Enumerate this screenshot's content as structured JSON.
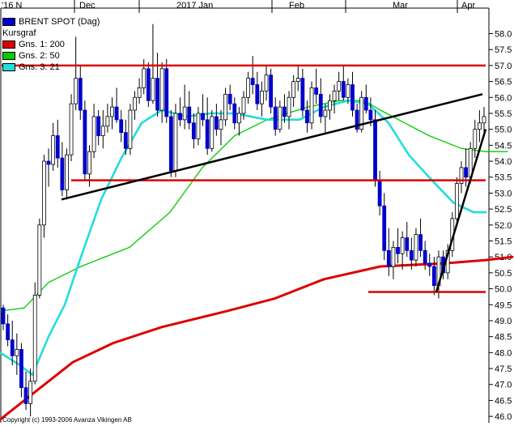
{
  "chart_data": {
    "type": "candlestick",
    "title": "BRENT SPOT (Dag)",
    "chart_label": "Kursgraf",
    "copyright": "Copyright (c) 1993-2006 Avanza Vikingen AB",
    "x_labels": [
      "'16 N",
      "Dec",
      "2017 Jan",
      "Feb",
      "Mar",
      "Apr"
    ],
    "y_ticks": [
      "46.0",
      "46.5",
      "47.0",
      "47.5",
      "48.0",
      "48.5",
      "49.0",
      "49.5",
      "50.0",
      "50.5",
      "51.0",
      "51.5",
      "52.0",
      "52.5",
      "53.0",
      "53.5",
      "54.0",
      "54.5",
      "55.0",
      "55.5",
      "56.0",
      "56.5",
      "57.0",
      "57.5",
      "58.0"
    ],
    "ylim": [
      45.8,
      58.8
    ],
    "grid": false,
    "legend_position": "top-left",
    "colors": {
      "candle": "#0000cc",
      "ma200": "#dd0000",
      "ma50": "#00cc00",
      "ma21": "#22dddd",
      "level": "#dd0000",
      "trend": "#000000"
    },
    "legend": [
      {
        "label": "BRENT SPOT (Dag)",
        "color": "#0000cc"
      },
      {
        "label": "Kursgraf",
        "color": ""
      },
      {
        "label": "Gns. 1: 200",
        "color": "#dd0000"
      },
      {
        "label": "Gns. 2: 50",
        "color": "#00cc00"
      },
      {
        "label": "Gns. 3: 21",
        "color": "#22dddd"
      }
    ],
    "ohlc": [
      [
        49.4,
        49.5,
        48.7,
        48.9
      ],
      [
        48.9,
        49.2,
        48.2,
        48.4
      ],
      [
        48.4,
        49.0,
        47.6,
        47.9
      ],
      [
        47.9,
        48.6,
        47.3,
        48.1
      ],
      [
        48.1,
        48.3,
        46.6,
        46.9
      ],
      [
        46.9,
        47.4,
        46.2,
        46.4
      ],
      [
        46.4,
        47.5,
        46.0,
        47.1
      ],
      [
        47.1,
        50.2,
        47.0,
        49.8
      ],
      [
        49.8,
        52.2,
        49.7,
        52.0
      ],
      [
        52.0,
        54.2,
        51.6,
        54.0
      ],
      [
        54.0,
        54.4,
        53.2,
        53.9
      ],
      [
        53.9,
        55.2,
        53.7,
        54.8
      ],
      [
        54.8,
        55.3,
        53.8,
        54.1
      ],
      [
        54.1,
        54.6,
        52.9,
        53.1
      ],
      [
        53.1,
        54.4,
        52.8,
        54.2
      ],
      [
        54.2,
        56.1,
        54.0,
        55.8
      ],
      [
        55.8,
        57.9,
        55.6,
        56.6
      ],
      [
        56.6,
        57.0,
        55.3,
        55.6
      ],
      [
        55.6,
        55.9,
        53.4,
        53.6
      ],
      [
        53.6,
        54.5,
        53.2,
        54.3
      ],
      [
        54.3,
        55.8,
        54.1,
        55.4
      ],
      [
        55.4,
        55.6,
        54.5,
        54.8
      ],
      [
        54.8,
        55.6,
        54.4,
        55.1
      ],
      [
        55.1,
        55.8,
        54.9,
        55.4
      ],
      [
        55.4,
        56.0,
        55.0,
        55.7
      ],
      [
        55.7,
        56.3,
        55.2,
        55.3
      ],
      [
        55.3,
        55.6,
        54.6,
        54.9
      ],
      [
        54.9,
        55.3,
        54.2,
        54.4
      ],
      [
        54.4,
        55.8,
        54.2,
        55.6
      ],
      [
        55.6,
        56.2,
        55.3,
        56.0
      ],
      [
        56.0,
        56.6,
        55.8,
        56.3
      ],
      [
        56.3,
        57.2,
        56.1,
        56.9
      ],
      [
        56.9,
        57.1,
        55.7,
        55.9
      ],
      [
        55.9,
        58.3,
        55.8,
        56.6
      ],
      [
        56.6,
        57.4,
        55.4,
        55.6
      ],
      [
        55.6,
        57.1,
        55.2,
        56.9
      ],
      [
        56.9,
        57.2,
        55.2,
        55.4
      ],
      [
        55.4,
        55.6,
        53.5,
        53.7
      ],
      [
        53.7,
        55.8,
        53.5,
        55.5
      ],
      [
        55.5,
        56.0,
        55.1,
        55.3
      ],
      [
        55.3,
        56.4,
        55.0,
        55.7
      ],
      [
        55.7,
        56.2,
        55.0,
        55.2
      ],
      [
        55.2,
        55.5,
        54.4,
        54.7
      ],
      [
        54.7,
        55.7,
        54.5,
        55.5
      ],
      [
        55.5,
        56.1,
        55.1,
        55.3
      ],
      [
        55.3,
        56.0,
        54.2,
        54.4
      ],
      [
        54.4,
        55.6,
        54.3,
        55.4
      ],
      [
        55.4,
        55.8,
        54.8,
        55.0
      ],
      [
        55.0,
        55.6,
        54.5,
        55.3
      ],
      [
        55.3,
        56.3,
        55.1,
        56.1
      ],
      [
        56.1,
        56.4,
        55.6,
        55.8
      ],
      [
        55.8,
        56.0,
        55.0,
        55.2
      ],
      [
        55.2,
        55.7,
        54.8,
        55.5
      ],
      [
        55.5,
        56.2,
        55.3,
        56.0
      ],
      [
        56.0,
        56.8,
        55.8,
        56.6
      ],
      [
        56.6,
        57.3,
        56.1,
        56.4
      ],
      [
        56.4,
        56.8,
        55.6,
        55.8
      ],
      [
        55.8,
        56.5,
        55.4,
        56.2
      ],
      [
        56.2,
        57.0,
        55.9,
        56.7
      ],
      [
        56.7,
        56.9,
        55.5,
        55.7
      ],
      [
        55.7,
        56.0,
        54.8,
        55.0
      ],
      [
        55.0,
        55.9,
        54.9,
        55.7
      ],
      [
        55.7,
        56.1,
        55.2,
        55.4
      ],
      [
        55.4,
        56.2,
        55.0,
        56.0
      ],
      [
        56.0,
        56.7,
        55.7,
        56.5
      ],
      [
        56.5,
        57.0,
        56.2,
        56.6
      ],
      [
        56.6,
        56.9,
        55.4,
        55.6
      ],
      [
        55.6,
        55.9,
        54.9,
        55.2
      ],
      [
        55.2,
        56.5,
        55.0,
        56.3
      ],
      [
        56.3,
        56.9,
        55.8,
        56.1
      ],
      [
        56.1,
        56.6,
        55.2,
        55.4
      ],
      [
        55.4,
        55.8,
        54.9,
        55.6
      ],
      [
        55.6,
        56.1,
        55.3,
        55.9
      ],
      [
        55.9,
        56.4,
        55.5,
        56.2
      ],
      [
        56.2,
        56.8,
        55.9,
        56.5
      ],
      [
        56.5,
        57.0,
        55.9,
        56.0
      ],
      [
        56.0,
        56.6,
        55.8,
        56.4
      ],
      [
        56.4,
        56.8,
        55.4,
        55.6
      ],
      [
        55.6,
        55.8,
        54.9,
        55.0
      ],
      [
        55.0,
        56.2,
        54.9,
        56.0
      ],
      [
        56.0,
        56.4,
        55.5,
        55.6
      ],
      [
        55.6,
        56.0,
        55.1,
        55.3
      ],
      [
        55.3,
        55.6,
        53.2,
        53.4
      ],
      [
        53.4,
        53.7,
        52.3,
        52.6
      ],
      [
        52.6,
        53.0,
        50.9,
        51.2
      ],
      [
        51.2,
        51.9,
        50.4,
        50.7
      ],
      [
        50.7,
        51.5,
        50.3,
        51.3
      ],
      [
        51.3,
        51.9,
        50.8,
        51.1
      ],
      [
        51.1,
        51.8,
        50.6,
        51.6
      ],
      [
        51.6,
        52.1,
        51.0,
        51.2
      ],
      [
        51.2,
        51.6,
        50.6,
        50.9
      ],
      [
        50.9,
        51.9,
        50.7,
        51.7
      ],
      [
        51.7,
        52.2,
        51.0,
        51.2
      ],
      [
        51.2,
        51.5,
        50.6,
        50.8
      ],
      [
        50.8,
        51.1,
        50.4,
        50.7
      ],
      [
        50.7,
        51.0,
        49.8,
        50.1
      ],
      [
        50.1,
        51.2,
        49.7,
        51.0
      ],
      [
        51.0,
        51.2,
        50.3,
        50.5
      ],
      [
        50.5,
        51.4,
        50.3,
        51.2
      ],
      [
        51.2,
        52.4,
        51.0,
        52.2
      ],
      [
        52.2,
        53.5,
        52.0,
        53.3
      ],
      [
        53.3,
        54.0,
        53.0,
        53.8
      ],
      [
        53.8,
        54.4,
        53.2,
        53.5
      ],
      [
        53.5,
        54.6,
        53.3,
        54.4
      ],
      [
        54.4,
        55.3,
        54.1,
        55.0
      ],
      [
        55.0,
        55.6,
        54.6,
        55.2
      ],
      [
        55.2,
        55.7,
        54.8,
        55.4
      ]
    ],
    "ma200": [
      [
        0,
        45.9
      ],
      [
        40,
        46.7
      ],
      [
        90,
        47.7
      ],
      [
        140,
        48.3
      ],
      [
        200,
        48.8
      ],
      [
        280,
        49.3
      ],
      [
        340,
        49.7
      ],
      [
        400,
        50.3
      ],
      [
        470,
        50.7
      ],
      [
        550,
        50.8
      ],
      [
        600,
        50.9
      ],
      [
        633,
        51.0
      ]
    ],
    "ma50": [
      [
        0,
        49.3
      ],
      [
        30,
        49.4
      ],
      [
        60,
        50.2
      ],
      [
        100,
        50.7
      ],
      [
        160,
        51.3
      ],
      [
        210,
        52.4
      ],
      [
        250,
        53.8
      ],
      [
        290,
        54.8
      ],
      [
        330,
        55.3
      ],
      [
        380,
        55.7
      ],
      [
        420,
        55.9
      ],
      [
        450,
        55.9
      ],
      [
        470,
        55.6
      ],
      [
        500,
        55.2
      ],
      [
        530,
        54.8
      ],
      [
        570,
        54.4
      ],
      [
        600,
        54.3
      ],
      [
        627,
        54.3
      ]
    ],
    "ma21": [
      [
        0,
        48.0
      ],
      [
        25,
        47.6
      ],
      [
        40,
        47.3
      ],
      [
        60,
        48.5
      ],
      [
        80,
        49.5
      ],
      [
        100,
        51.0
      ],
      [
        125,
        52.8
      ],
      [
        150,
        54.1
      ],
      [
        175,
        55.2
      ],
      [
        200,
        55.6
      ],
      [
        230,
        55.4
      ],
      [
        260,
        55.5
      ],
      [
        290,
        55.5
      ],
      [
        330,
        55.3
      ],
      [
        370,
        55.3
      ],
      [
        400,
        55.7
      ],
      [
        430,
        55.9
      ],
      [
        455,
        55.8
      ],
      [
        480,
        55.2
      ],
      [
        505,
        54.2
      ],
      [
        530,
        53.5
      ],
      [
        560,
        52.7
      ],
      [
        585,
        52.4
      ],
      [
        600,
        52.4
      ]
    ],
    "levels": [
      {
        "y": 57.0,
        "x0": 2,
        "x1": 600
      },
      {
        "y": 53.4,
        "x0": 88,
        "x1": 600
      },
      {
        "y": 49.9,
        "x0": 455,
        "x1": 600
      }
    ],
    "trendlines": [
      {
        "x0": 76,
        "y0": 52.8,
        "x1": 596,
        "y1": 56.1
      },
      {
        "x0": 539,
        "y0": 49.9,
        "x1": 600,
        "y1": 55.0
      }
    ]
  }
}
